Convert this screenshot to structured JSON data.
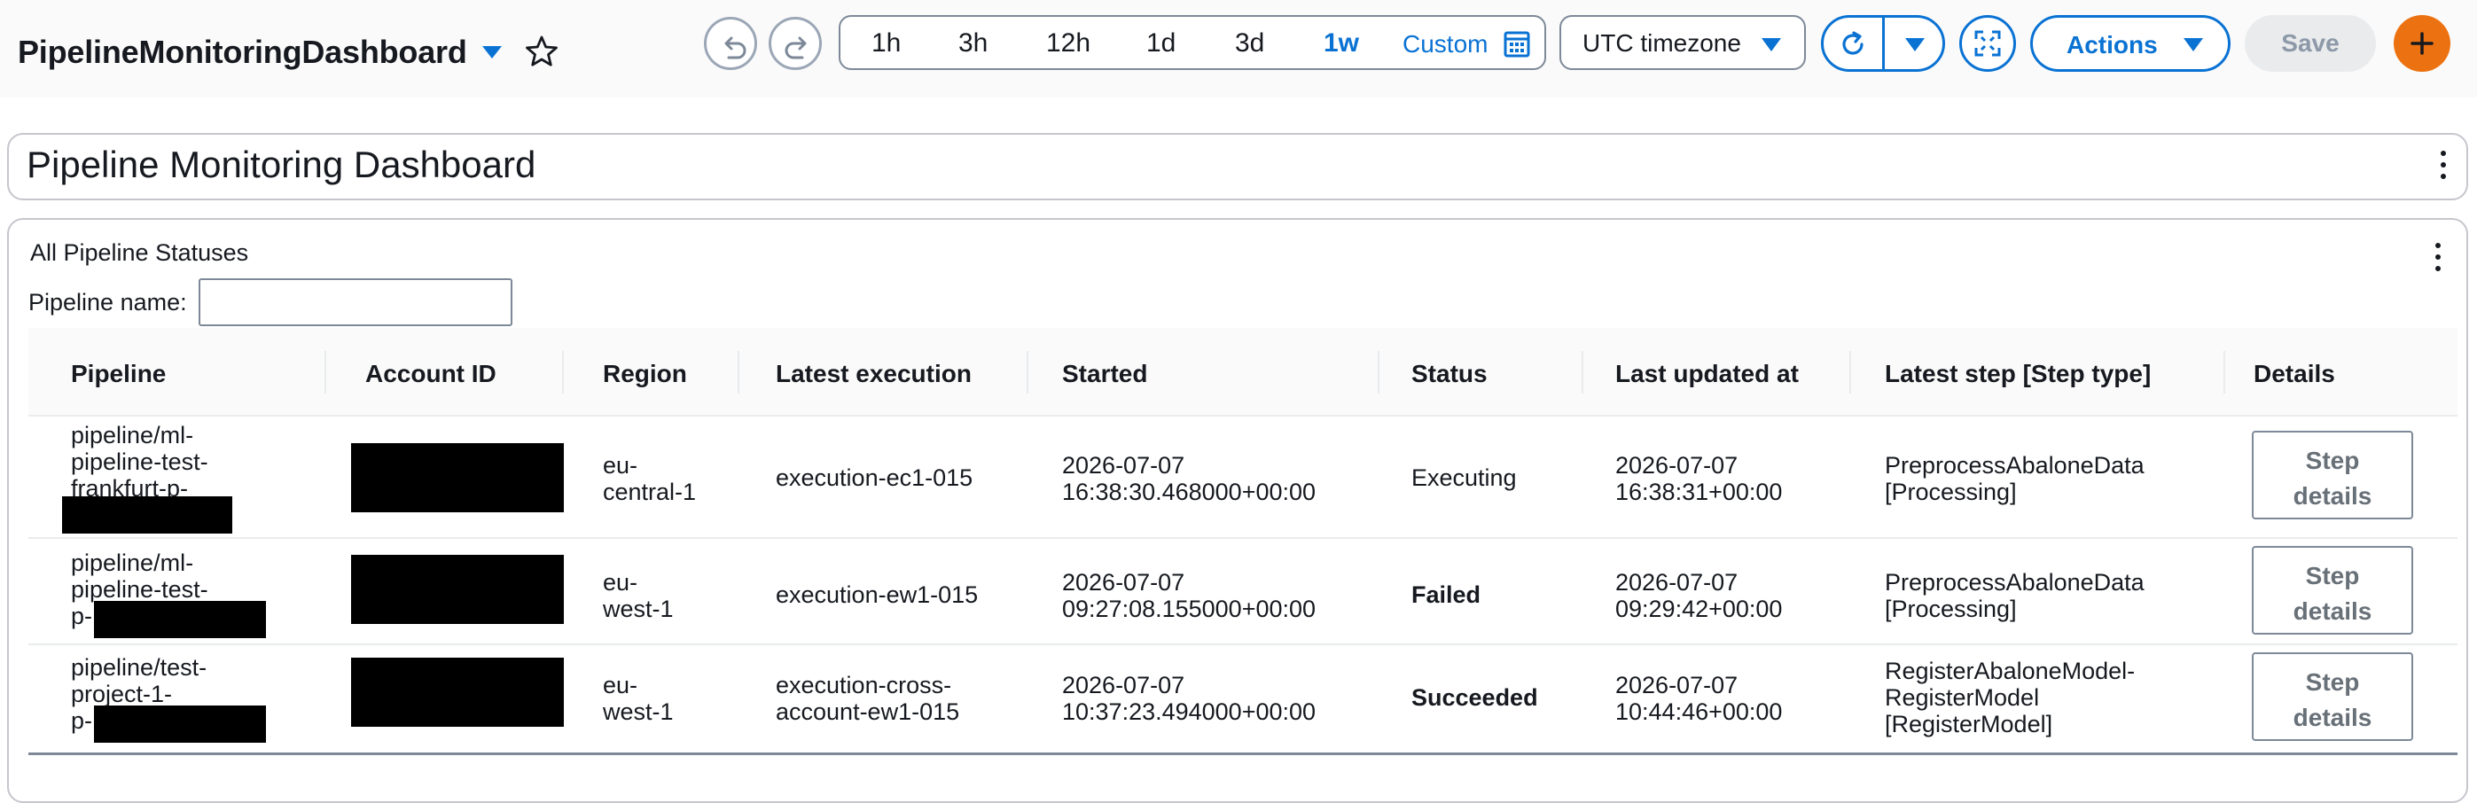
{
  "toolbar": {
    "dashboard_name": "PipelineMonitoringDashboard",
    "time_options": [
      "1h",
      "3h",
      "12h",
      "1d",
      "3d",
      "1w"
    ],
    "active_time_option": "1w",
    "custom_label": "Custom",
    "timezone_label": "UTC timezone",
    "actions_label": "Actions",
    "save_label": "Save",
    "accent_color": "#0972d3",
    "add_color": "#ec7211",
    "icons": [
      "undo-icon",
      "redo-icon",
      "calendar-icon",
      "refresh-icon",
      "fullscreen-icon",
      "plus-icon",
      "star-icon"
    ]
  },
  "text_widget": {
    "title": "Pipeline Monitoring Dashboard"
  },
  "table_widget": {
    "title": "All Pipeline Statuses",
    "filter": {
      "label": "Pipeline name:",
      "value": "",
      "placeholder": ""
    },
    "columns": [
      "Pipeline",
      "Account ID",
      "Region",
      "Latest execution",
      "Started",
      "Status",
      "Last updated at",
      "Latest step [Step type]",
      "Details"
    ],
    "rows": [
      {
        "pipeline_lines": [
          "pipeline/ml-",
          "pipeline-test-",
          "frankfurt-p-"
        ],
        "region_lines": [
          "eu-",
          "central-1"
        ],
        "execution_lines": [
          "execution-ec1-015"
        ],
        "started_lines": [
          "2026-07-07",
          "16:38:30.468000+00:00"
        ],
        "status": "Executing",
        "updated_lines": [
          "2026-07-07",
          "16:38:31+00:00"
        ],
        "step_lines": [
          "PreprocessAbaloneData",
          "[Processing]"
        ],
        "details_lines": [
          "Step",
          "details"
        ]
      },
      {
        "pipeline_lines": [
          "pipeline/ml-",
          "pipeline-test-",
          "p-"
        ],
        "region_lines": [
          "eu-",
          "west-1"
        ],
        "execution_lines": [
          "execution-ew1-015"
        ],
        "started_lines": [
          "2026-07-07",
          "09:27:08.155000+00:00"
        ],
        "status": "Failed",
        "updated_lines": [
          "2026-07-07",
          "09:29:42+00:00"
        ],
        "step_lines": [
          "PreprocessAbaloneData",
          "[Processing]"
        ],
        "details_lines": [
          "Step",
          "details"
        ]
      },
      {
        "pipeline_lines": [
          "pipeline/test-",
          "project-1-",
          "p-"
        ],
        "region_lines": [
          "eu-",
          "west-1"
        ],
        "execution_lines": [
          "execution-cross-",
          "account-ew1-015"
        ],
        "started_lines": [
          "2026-07-07",
          "10:37:23.494000+00:00"
        ],
        "status": "Succeeded",
        "updated_lines": [
          "2026-07-07",
          "10:44:46+00:00"
        ],
        "step_lines": [
          "RegisterAbaloneModel-",
          "RegisterModel",
          "[RegisterModel]"
        ],
        "details_lines": [
          "Step",
          "details"
        ]
      }
    ]
  }
}
